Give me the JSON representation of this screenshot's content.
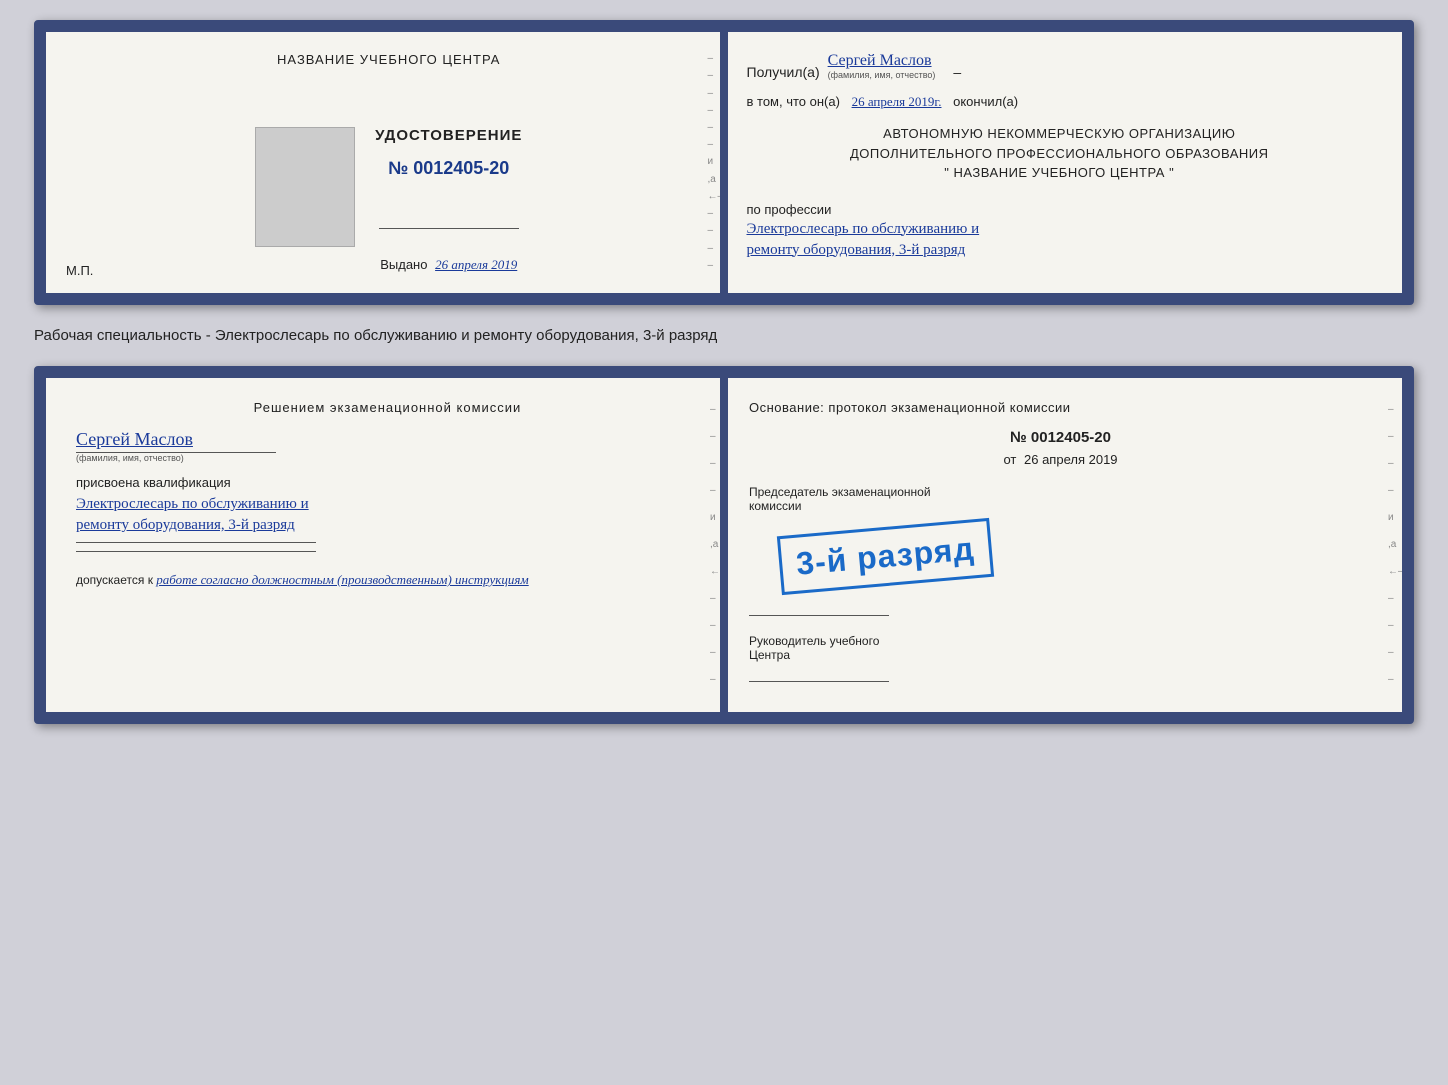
{
  "upper_cert": {
    "left": {
      "center_title": "НАЗВАНИЕ УЧЕБНОГО ЦЕНТРА",
      "udost_label": "УДОСТОВЕРЕНИЕ",
      "udost_number": "№ 0012405-20",
      "vydano_label": "Выдано",
      "vydano_date": "26 апреля 2019",
      "mp_label": "М.П."
    },
    "right": {
      "poluchil_label": "Получил(а)",
      "recipient_name": "Сергей Маслов",
      "fio_label": "(фамилия, имя, отчество)",
      "dash": "–",
      "vtom_label": "в том, что он(а)",
      "date_value": "26 апреля 2019г.",
      "okonchil_label": "окончил(а)",
      "avtonomnuyu_line1": "АВТОНОМНУЮ НЕКОММЕРЧЕСКУЮ ОРГАНИЗАЦИЮ",
      "avtonomnuyu_line2": "ДОПОЛНИТЕЛЬНОГО ПРОФЕССИОНАЛЬНОГО ОБРАЗОВАНИЯ",
      "avtonomnuyu_line3": "\"   НАЗВАНИЕ УЧЕБНОГО ЦЕНТРА   \"",
      "po_professii_label": "по профессии",
      "profession_line1": "Электрослесарь по обслуживанию и",
      "profession_line2": "ремонту оборудования, 3-й разряд"
    }
  },
  "caption": {
    "text": "Рабочая специальность - Электрослесарь по обслуживанию и ремонту оборудования, 3-й разряд"
  },
  "lower_cert": {
    "left": {
      "reshen_title": "Решением  экзаменационной  комиссии",
      "name_handwritten": "Сергей Маслов",
      "fio_label": "(фамилия, имя, отчество)",
      "prisvoena_label": "присвоена квалификация",
      "qualification_line1": "Электрослесарь по обслуживанию и",
      "qualification_line2": "ремонту оборудования, 3-й разряд",
      "dopuskaetsya_label": "допускается к",
      "dopusk_text": "работе согласно должностным (производственным) инструкциям"
    },
    "right": {
      "osnovanie_text": "Основание:  протокол  экзаменационной  комиссии",
      "number_label": "№  0012405-20",
      "ot_label": "от",
      "ot_date": "26 апреля 2019",
      "predsedatel_line1": "Председатель экзаменационной",
      "predsedatel_line2": "комиссии",
      "stamp_text": "3-й разряд",
      "rukovoditel_line1": "Руководитель учебного",
      "rukovoditel_line2": "Центра"
    }
  }
}
